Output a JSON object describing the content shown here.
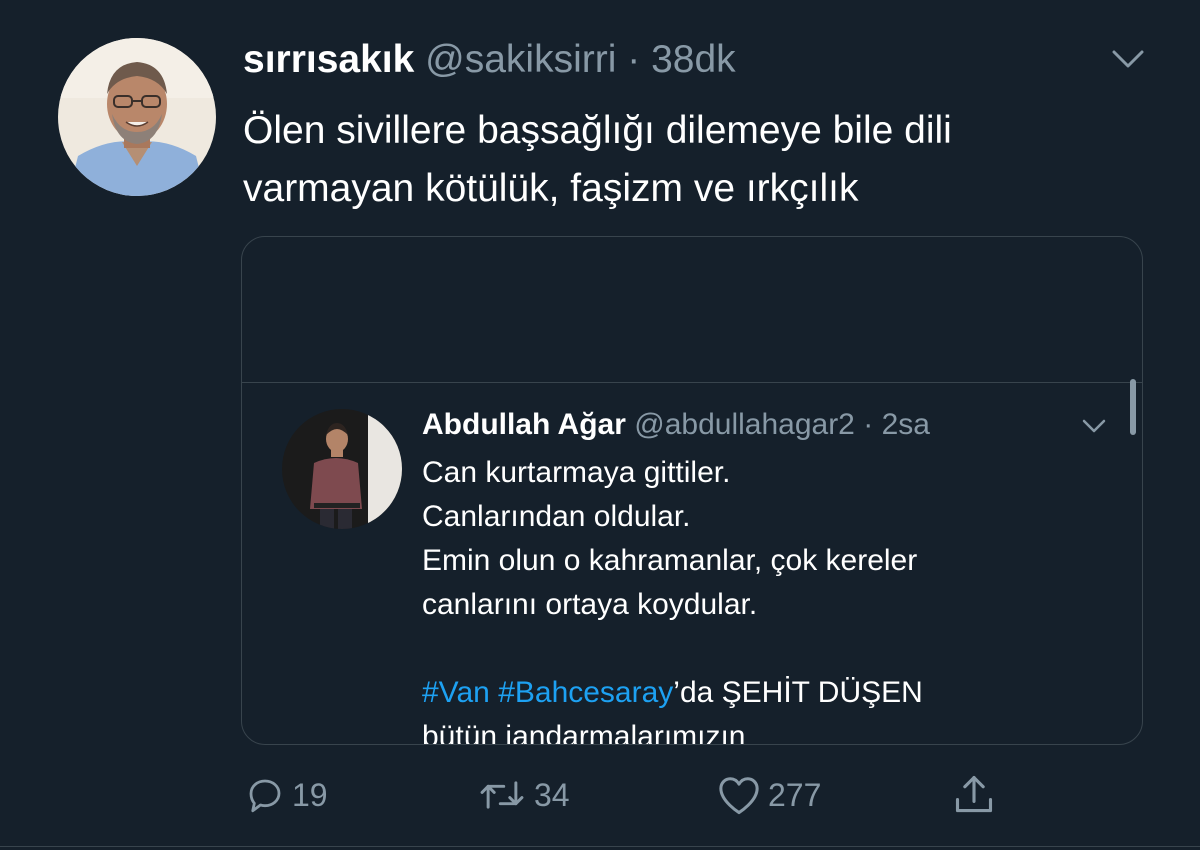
{
  "tweet": {
    "display_name": "sırrısakık",
    "handle": "@sakiksirri",
    "separator": "·",
    "time": "38dk",
    "text_lines": [
      "Ölen sivillere başsağlığı dilemeye bile dili",
      "varmayan kötülük, faşizm ve ırkçılık"
    ],
    "avatar_icon": "profile-photo",
    "menu_icon": "chevron-down-icon"
  },
  "quoted": {
    "display_name": "Abdullah Ağar",
    "handle": "@abdullahagar2",
    "separator": "·",
    "time": "2sa",
    "text_lines": [
      "Can kurtarmaya gittiler.",
      "Canlarından oldular.",
      "Emin olun o kahramanlar, çok kereler",
      "canlarını ortaya koydular."
    ],
    "hashtag_1": "#Van",
    "hashtag_2": "#Bahcesaray",
    "hashtag_suffix": "’da ŞEHİT DÜŞEN",
    "last_line_partial": "bütün jandarmalarımızın"
  },
  "actions": {
    "reply_count": "19",
    "retweet_count": "34",
    "like_count": "277"
  },
  "colors": {
    "background": "#15202b",
    "secondary_text": "#8899a6",
    "border": "#38444d",
    "link": "#1da1f2"
  }
}
